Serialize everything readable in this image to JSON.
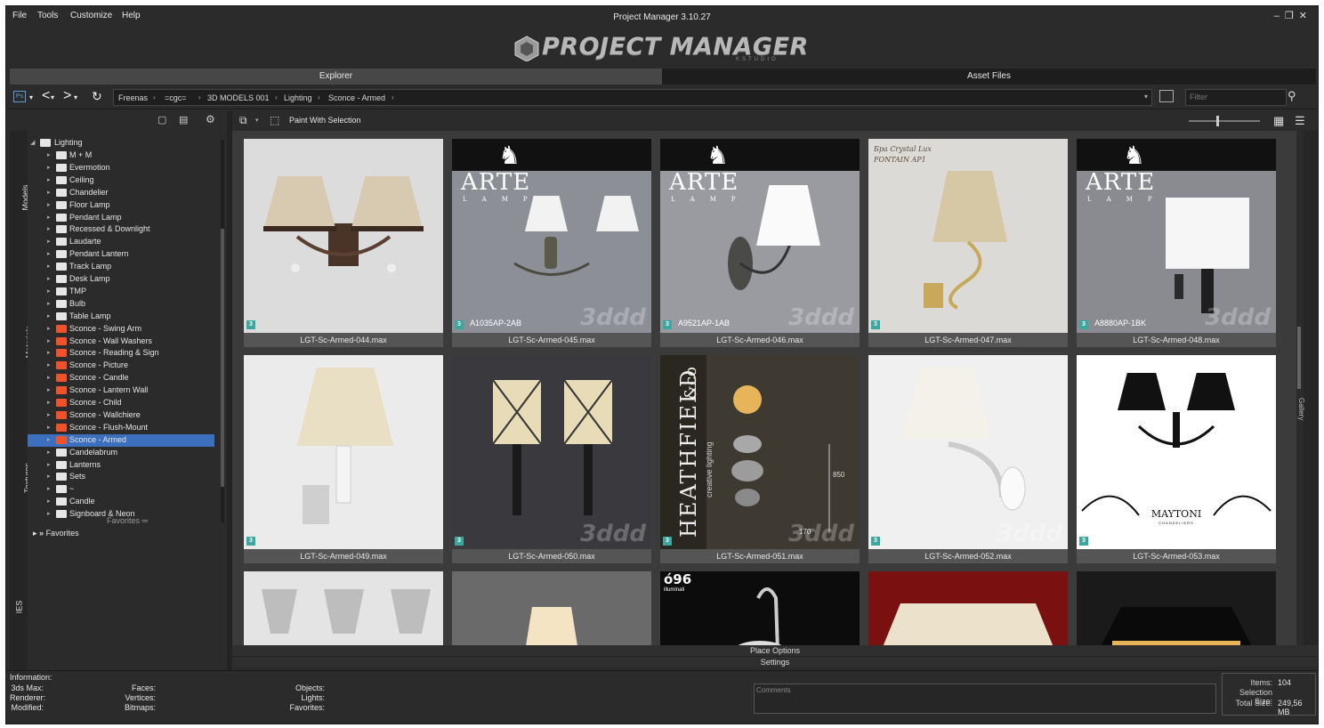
{
  "window": {
    "title": "Project Manager 3.10.27",
    "menu": [
      "File",
      "Tools",
      "Customize",
      "Help"
    ],
    "logo": "PROJECT MANAGER",
    "logo_sub": "KSTUDIO"
  },
  "tabs": {
    "explorer": "Explorer",
    "asset_files": "Asset Files"
  },
  "breadcrumb": [
    "Freenas",
    "=cgc=",
    "3D MODELS 001",
    "Lighting",
    "Sconce - Armed"
  ],
  "filter": {
    "placeholder": "Filter"
  },
  "side_tabs": [
    "Models",
    "Materials",
    "Textures",
    "IES"
  ],
  "tree": {
    "root": "Lighting",
    "items": [
      {
        "label": "M + M",
        "orange": false
      },
      {
        "label": "Evermotion",
        "orange": false
      },
      {
        "label": "Ceiling",
        "orange": false
      },
      {
        "label": "Chandelier",
        "orange": false
      },
      {
        "label": "Floor Lamp",
        "orange": false
      },
      {
        "label": "Pendant Lamp",
        "orange": false
      },
      {
        "label": "Recessed & Downlight",
        "orange": false
      },
      {
        "label": "Laudarte",
        "orange": false
      },
      {
        "label": "Pendant Lantern",
        "orange": false
      },
      {
        "label": "Track Lamp",
        "orange": false
      },
      {
        "label": "Desk Lamp",
        "orange": false
      },
      {
        "label": "TMP",
        "orange": false
      },
      {
        "label": "Bulb",
        "orange": false
      },
      {
        "label": "Table Lamp",
        "orange": false
      },
      {
        "label": "Sconce - Swing Arm",
        "orange": true
      },
      {
        "label": "Sconce - Wall Washers",
        "orange": true
      },
      {
        "label": "Sconce - Reading & Sign",
        "orange": true
      },
      {
        "label": "Sconce - Picture",
        "orange": true
      },
      {
        "label": "Sconce - Candle",
        "orange": true
      },
      {
        "label": "Sconce - Lantern Wall",
        "orange": true
      },
      {
        "label": "Sconce - Child",
        "orange": true
      },
      {
        "label": "Sconce - Wallchiere",
        "orange": true
      },
      {
        "label": "Sconce - Flush-Mount",
        "orange": true
      },
      {
        "label": "Sconce - Armed",
        "orange": true,
        "selected": true
      },
      {
        "label": "Candelabrum",
        "orange": false
      },
      {
        "label": "Lanterns",
        "orange": false
      },
      {
        "label": "Sets",
        "orange": false
      },
      {
        "label": "~",
        "orange": false
      },
      {
        "label": "Candle",
        "orange": false
      },
      {
        "label": "Signboard & Neon",
        "orange": false
      }
    ],
    "favorites_header": "Favorites",
    "favorites_item": "Favorites"
  },
  "toolbar": {
    "paint_label": "Paint With Selection"
  },
  "cards": [
    {
      "label": "LGT-Sc-Armed-044.max",
      "code": "",
      "brand": ""
    },
    {
      "label": "LGT-Sc-Armed-045.max",
      "code": "A1035AP-2AB",
      "brand": "arte"
    },
    {
      "label": "LGT-Sc-Armed-046.max",
      "code": "A9521AP-1AB",
      "brand": "arte"
    },
    {
      "label": "LGT-Sc-Armed-047.max",
      "code": "",
      "brand": "note"
    },
    {
      "label": "LGT-Sc-Armed-048.max",
      "code": "A8880AP-1BK",
      "brand": "arte"
    },
    {
      "label": "LGT-Sc-Armed-049.max",
      "code": "",
      "brand": ""
    },
    {
      "label": "LGT-Sc-Armed-050.max",
      "code": "",
      "brand": ""
    },
    {
      "label": "LGT-Sc-Armed-051.max",
      "code": "",
      "brand": "heathfield"
    },
    {
      "label": "LGT-Sc-Armed-052.max",
      "code": "",
      "brand": ""
    },
    {
      "label": "LGT-Sc-Armed-053.max",
      "code": "",
      "brand": "maytoni"
    }
  ],
  "badge": "3",
  "watermark": "3ddd",
  "arte": {
    "name": "ARTE",
    "sub": "LAMP"
  },
  "note047": {
    "line1": "Бра Crystal Lux",
    "line2": "FONTAIN AP1"
  },
  "heathfield": {
    "name": "HEATHFIELD",
    "co": "&co",
    "tag": "creative lighting",
    "dim1": "850",
    "dim2": "170"
  },
  "maytoni": {
    "name": "MAYTONI",
    "sub": "CHANDELIERS"
  },
  "illuminati": {
    "logo": "ó96",
    "text": "illuminati"
  },
  "gallery_tab": "Gallery",
  "bottom": {
    "place_options": "Place Options",
    "settings": "Settings"
  },
  "info": {
    "title": "Information:",
    "labels_col1": [
      "3ds Max:",
      "Renderer:",
      "Modified:"
    ],
    "labels_col2": [
      "Faces:",
      "Vertices:",
      "Bitmaps:"
    ],
    "labels_col3": [
      "Objects:",
      "Lights:",
      "Favorites:"
    ],
    "comments": "Comments",
    "items_label": "Items:",
    "items_value": "104",
    "selection_label": "Selection Size:",
    "total_label": "Total Size:",
    "total_value": "249,56 MB"
  }
}
